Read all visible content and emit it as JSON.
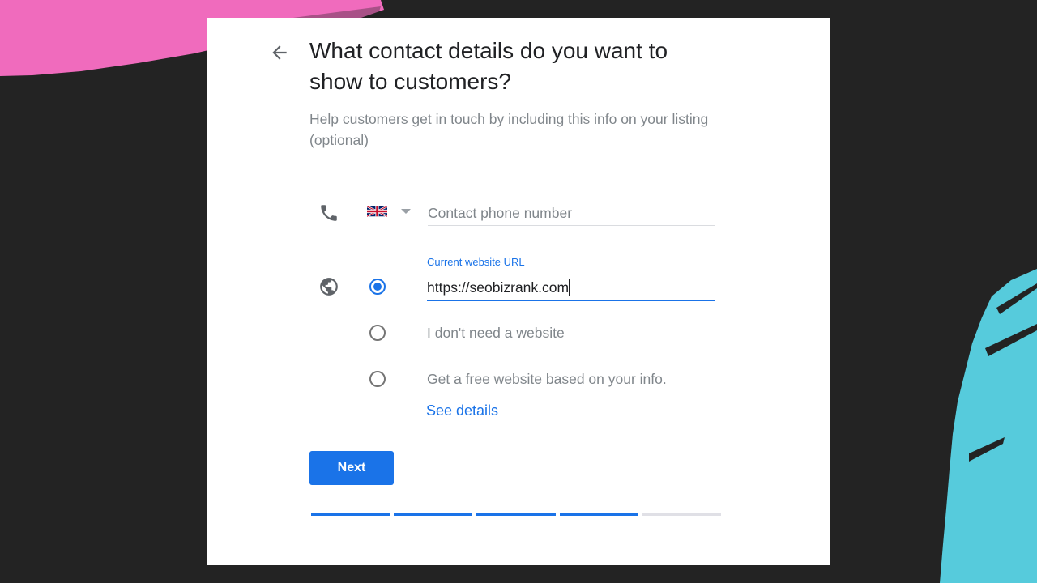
{
  "page": {
    "title": "What contact details do you want to show to customers?",
    "subtitle": "Help customers get in touch by including this info on your listing (optional)"
  },
  "phone": {
    "country": "United Kingdom",
    "placeholder": "Contact phone number",
    "value": ""
  },
  "website": {
    "field_label": "Current website URL",
    "value": "https://seobizrank.com",
    "options": [
      {
        "label": "",
        "selected": true
      },
      {
        "label": "I don't need a website",
        "selected": false
      },
      {
        "label": "Get a free website based on your info.",
        "selected": false
      }
    ],
    "see_details": "See details"
  },
  "actions": {
    "next_label": "Next"
  },
  "progress": {
    "total_steps": 5,
    "completed_steps": 4
  },
  "colors": {
    "accent": "#1a73e8",
    "background": "#232323",
    "card": "#ffffff",
    "pink_brush": "#f06bbd",
    "cyan_brush": "#56cbdc"
  }
}
